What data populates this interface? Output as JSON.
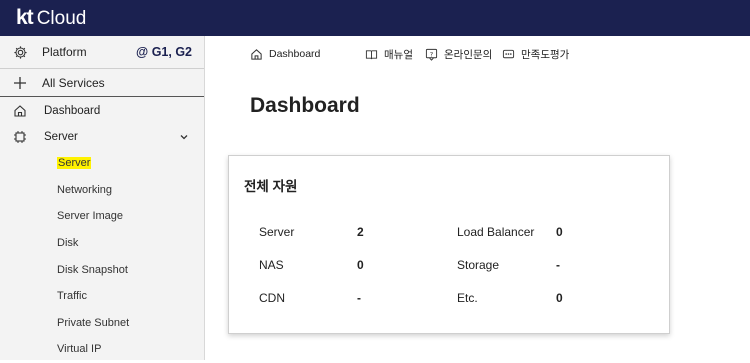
{
  "app": {
    "logo_kt": "kt",
    "logo_cloud": "Cloud"
  },
  "sidebar": {
    "platform_label": "Platform",
    "platform_region": "@ G1, G2",
    "all_services": "All Services",
    "dashboard": "Dashboard",
    "server_group": "Server",
    "sub_items": [
      "Server",
      "Networking",
      "Server Image",
      "Disk",
      "Disk Snapshot",
      "Traffic",
      "Private Subnet",
      "Virtual IP"
    ],
    "highlighted_item": "Server"
  },
  "nav": {
    "dashboard": "Dashboard",
    "manual": "매뉴얼",
    "inquiry": "온라인문의",
    "survey": "만족도평가"
  },
  "main": {
    "title": "Dashboard",
    "card_title": "전체 자원",
    "resources": {
      "server_label": "Server",
      "server_value": "2",
      "nas_label": "NAS",
      "nas_value": "0",
      "cdn_label": "CDN",
      "cdn_value": "-",
      "lb_label": "Load Balancer",
      "lb_value": "0",
      "storage_label": "Storage",
      "storage_value": "-",
      "etc_label": "Etc.",
      "etc_value": "0"
    }
  },
  "colors": {
    "topbar": "#1b2150",
    "highlight": "#fff200",
    "sidebar_bg": "#f3f3f3"
  }
}
